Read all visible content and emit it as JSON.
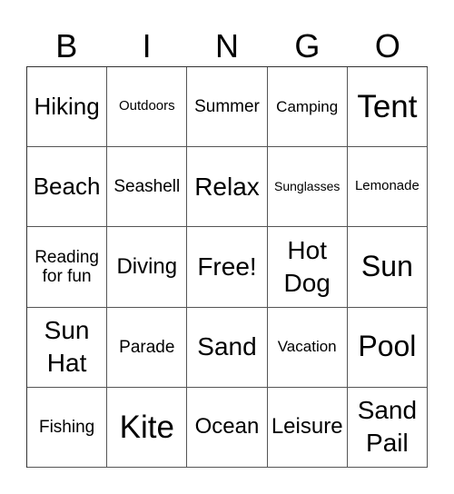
{
  "header": [
    "B",
    "I",
    "N",
    "G",
    "O"
  ],
  "cells": [
    [
      "Hiking",
      "Outdoors",
      "Summer",
      "Camping",
      "Tent"
    ],
    [
      "Beach",
      "Seashell",
      "Relax",
      "Sunglasses",
      "Lemonade"
    ],
    [
      "Reading for fun",
      "Diving",
      "Free!",
      "Hot Dog",
      "Sun"
    ],
    [
      "Sun Hat",
      "Parade",
      "Sand",
      "Vacation",
      "Pool"
    ],
    [
      "Fishing",
      "Kite",
      "Ocean",
      "Leisure",
      "Sand Pail"
    ]
  ]
}
